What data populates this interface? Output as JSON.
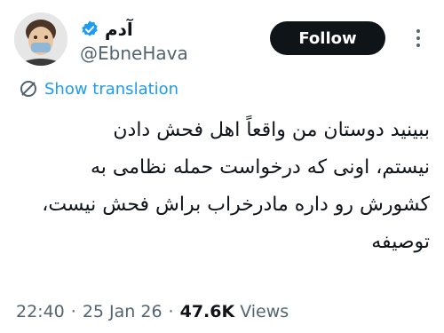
{
  "author": {
    "display_name": "آدم",
    "handle": "@EbneHava",
    "verified": true
  },
  "follow_label": "Follow",
  "translation_label": "Show translation",
  "tweet_lines": [
    "ببینید دوستان من واقعاً اهل فحش دادن",
    "نیستم، اونی که درخواست حمله نظامی به",
    "کشورش رو داره مادرخراب براش فحش نیست،",
    "توصیفه"
  ],
  "meta": {
    "time": "22:40",
    "date": "25 Jan 26",
    "views_count": "47.6K",
    "views_label": "Views",
    "separator": "·"
  },
  "colors": {
    "accent": "#1d9bf0",
    "text": "#0f1419",
    "secondary": "#536471",
    "button": "#0f1419"
  }
}
